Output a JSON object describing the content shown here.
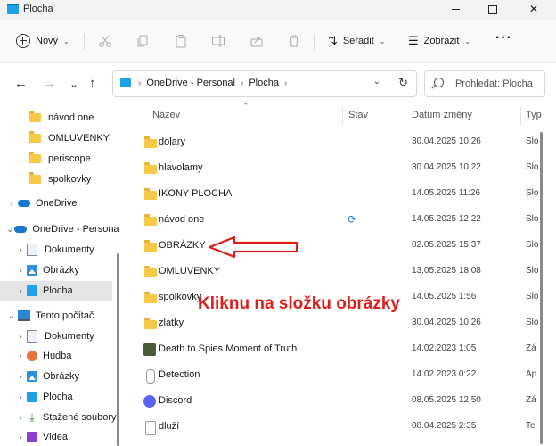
{
  "window": {
    "title": "Plocha"
  },
  "toolbar": {
    "new_label": "Nový",
    "sort_label": "Seřadit",
    "view_label": "Zobrazit",
    "more_label": "···"
  },
  "address": {
    "crumbs": [
      "OneDrive - Personal",
      "Plocha"
    ],
    "search_placeholder": "Prohledat: Plocha"
  },
  "sidebar": {
    "items": [
      {
        "label": "návod one"
      },
      {
        "label": "OMLUVENKY"
      },
      {
        "label": "periscope"
      },
      {
        "label": "spolkovky"
      },
      {
        "label": "OneDrive"
      },
      {
        "label": "OneDrive - Personal"
      },
      {
        "label": "Dokumenty"
      },
      {
        "label": "Obrázky"
      },
      {
        "label": "Plocha"
      },
      {
        "label": "Tento počítač"
      },
      {
        "label": "Dokumenty"
      },
      {
        "label": "Hudba"
      },
      {
        "label": "Obrázky"
      },
      {
        "label": "Plocha"
      },
      {
        "label": "Stažené soubory"
      },
      {
        "label": "Videa"
      }
    ]
  },
  "columns": {
    "name": "Název",
    "status": "Stav",
    "date": "Datum změny",
    "type": "Typ"
  },
  "files": [
    {
      "name": "dolary",
      "status": "",
      "date": "30.04.2025 10:26",
      "type": "Slo"
    },
    {
      "name": "hlavolamy",
      "status": "",
      "date": "30.04.2025 10:22",
      "type": "Slo"
    },
    {
      "name": "IKONY PLOCHA",
      "status": "",
      "date": "14.05.2025 11:26",
      "type": "Slo"
    },
    {
      "name": "návod one",
      "status": "sync",
      "date": "14.05.2025 12:22",
      "type": "Slo"
    },
    {
      "name": "OBRÁZKY",
      "status": "",
      "date": "02.05.2025 15:37",
      "type": "Slo"
    },
    {
      "name": "OMLUVENKY",
      "status": "",
      "date": "13.05.2025 18:08",
      "type": "Slo"
    },
    {
      "name": "spolkovky",
      "status": "",
      "date": "14.05.2025 1:56",
      "type": "Slo"
    },
    {
      "name": "zlatky",
      "status": "",
      "date": "30.04.2025 10:26",
      "type": "Slo"
    },
    {
      "name": "Death to Spies Moment of Truth",
      "status": "",
      "date": "14.02.2023 1:05",
      "type": "Zá"
    },
    {
      "name": "Detection",
      "status": "",
      "date": "14.02.2023 0:22",
      "type": "Ap"
    },
    {
      "name": "Discord",
      "status": "",
      "date": "08.05.2025 12:50",
      "type": "Zá"
    },
    {
      "name": "dluží",
      "status": "",
      "date": "08.04.2025 2:35",
      "type": "Te"
    }
  ],
  "annotation": {
    "text": "Kliknu na složku obrázky",
    "color": "#e21b1b"
  }
}
